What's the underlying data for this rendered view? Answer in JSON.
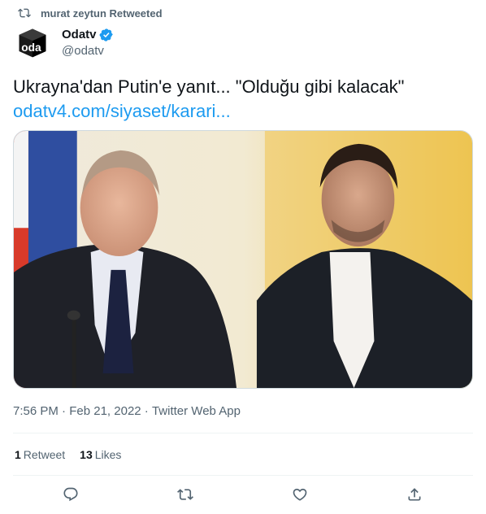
{
  "retweet_banner": {
    "text": "murat zeytun Retweeted",
    "icon": "retweet-icon"
  },
  "author": {
    "display_name": "Odatv",
    "handle": "@odatv",
    "verified": true,
    "avatar_icon": "odatv-logo"
  },
  "tweet": {
    "text": "Ukrayna'dan Putin'e yanıt... \"Olduğu gibi kalacak\"",
    "link": "odatv4.com/siyaset/karari..."
  },
  "meta": {
    "time": "7:56 PM",
    "separator1": " · ",
    "date": "Feb 21, 2022",
    "separator2": " · ",
    "source": "Twitter Web App"
  },
  "stats": {
    "retweets_count": "1",
    "retweets_label": "Retweet",
    "likes_count": "13",
    "likes_label": "Likes"
  },
  "actions": [
    "reply-icon",
    "retweet-icon",
    "like-icon",
    "share-icon"
  ],
  "colors": {
    "link": "#1d9bf0",
    "secondary": "#536471",
    "divider": "#eff3f4",
    "text": "#0f1419"
  }
}
